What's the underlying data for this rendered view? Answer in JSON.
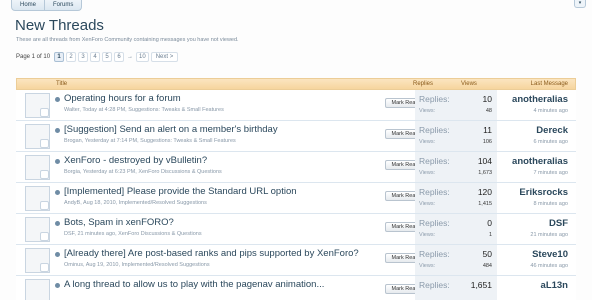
{
  "breadcrumb": [
    "Home",
    "Forums"
  ],
  "page": {
    "title": "New Threads",
    "description": "These are all threads from XenForo Community containing messages you have not viewed."
  },
  "pager": {
    "label": "Page 1 of 10",
    "pages": [
      "1",
      "2",
      "3",
      "4",
      "5",
      "6"
    ],
    "arrow": "→",
    "last": "10",
    "next": "Next >"
  },
  "columns": {
    "title": "Title",
    "replies": "Replies",
    "views": "Views",
    "last": "Last Message"
  },
  "labels": {
    "replies": "Replies:",
    "views": "Views:",
    "mark_read": "Mark Read"
  },
  "threads": [
    {
      "title": "Operating hours for a forum",
      "author": "Walter",
      "date": "Today at 4:28 PM",
      "forum": "Suggestions: Tweaks & Small Features",
      "replies": "10",
      "views": "48",
      "last_user": "anotheralias",
      "last_date": "4 minutes ago"
    },
    {
      "title": "[Suggestion] Send an alert on a member's birthday",
      "author": "Brogan",
      "date": "Yesterday at 7:14 PM",
      "forum": "Suggestions: Tweaks & Small Features",
      "replies": "11",
      "views": "106",
      "last_user": "Dereck",
      "last_date": "6 minutes ago"
    },
    {
      "title": "XenForo - destroyed by vBulletin?",
      "author": "Borgia",
      "date": "Yesterday at 6:23 PM",
      "forum": "XenForo Discussions & Questions",
      "replies": "104",
      "views": "1,673",
      "last_user": "anotheralias",
      "last_date": "7 minutes ago"
    },
    {
      "title": "[Implemented] Please provide the Standard URL option",
      "author": "AndyB",
      "date": "Aug 18, 2010",
      "forum": "Implemented/Resolved Suggestions",
      "replies": "120",
      "views": "1,415",
      "last_user": "Eriksrocks",
      "last_date": "8 minutes ago"
    },
    {
      "title": "Bots, Spam in xenFORO?",
      "author": "DSF",
      "date": "21 minutes ago",
      "forum": "XenForo Discussions & Questions",
      "replies": "0",
      "views": "1",
      "last_user": "DSF",
      "last_date": "21 minutes ago"
    },
    {
      "title": "[Already there] Are post-based ranks and pips supported by XenForo?",
      "author": "Ominus",
      "date": "Aug 19, 2010",
      "forum": "Implemented/Resolved Suggestions",
      "replies": "50",
      "views": "484",
      "last_user": "Steve10",
      "last_date": "46 minutes ago"
    },
    {
      "title": "A long thread to allow us to play with the pagenav animation...",
      "author": "",
      "date": "",
      "forum": "",
      "replies": "1,651",
      "views": "",
      "last_user": "aL13n",
      "last_date": ""
    }
  ]
}
